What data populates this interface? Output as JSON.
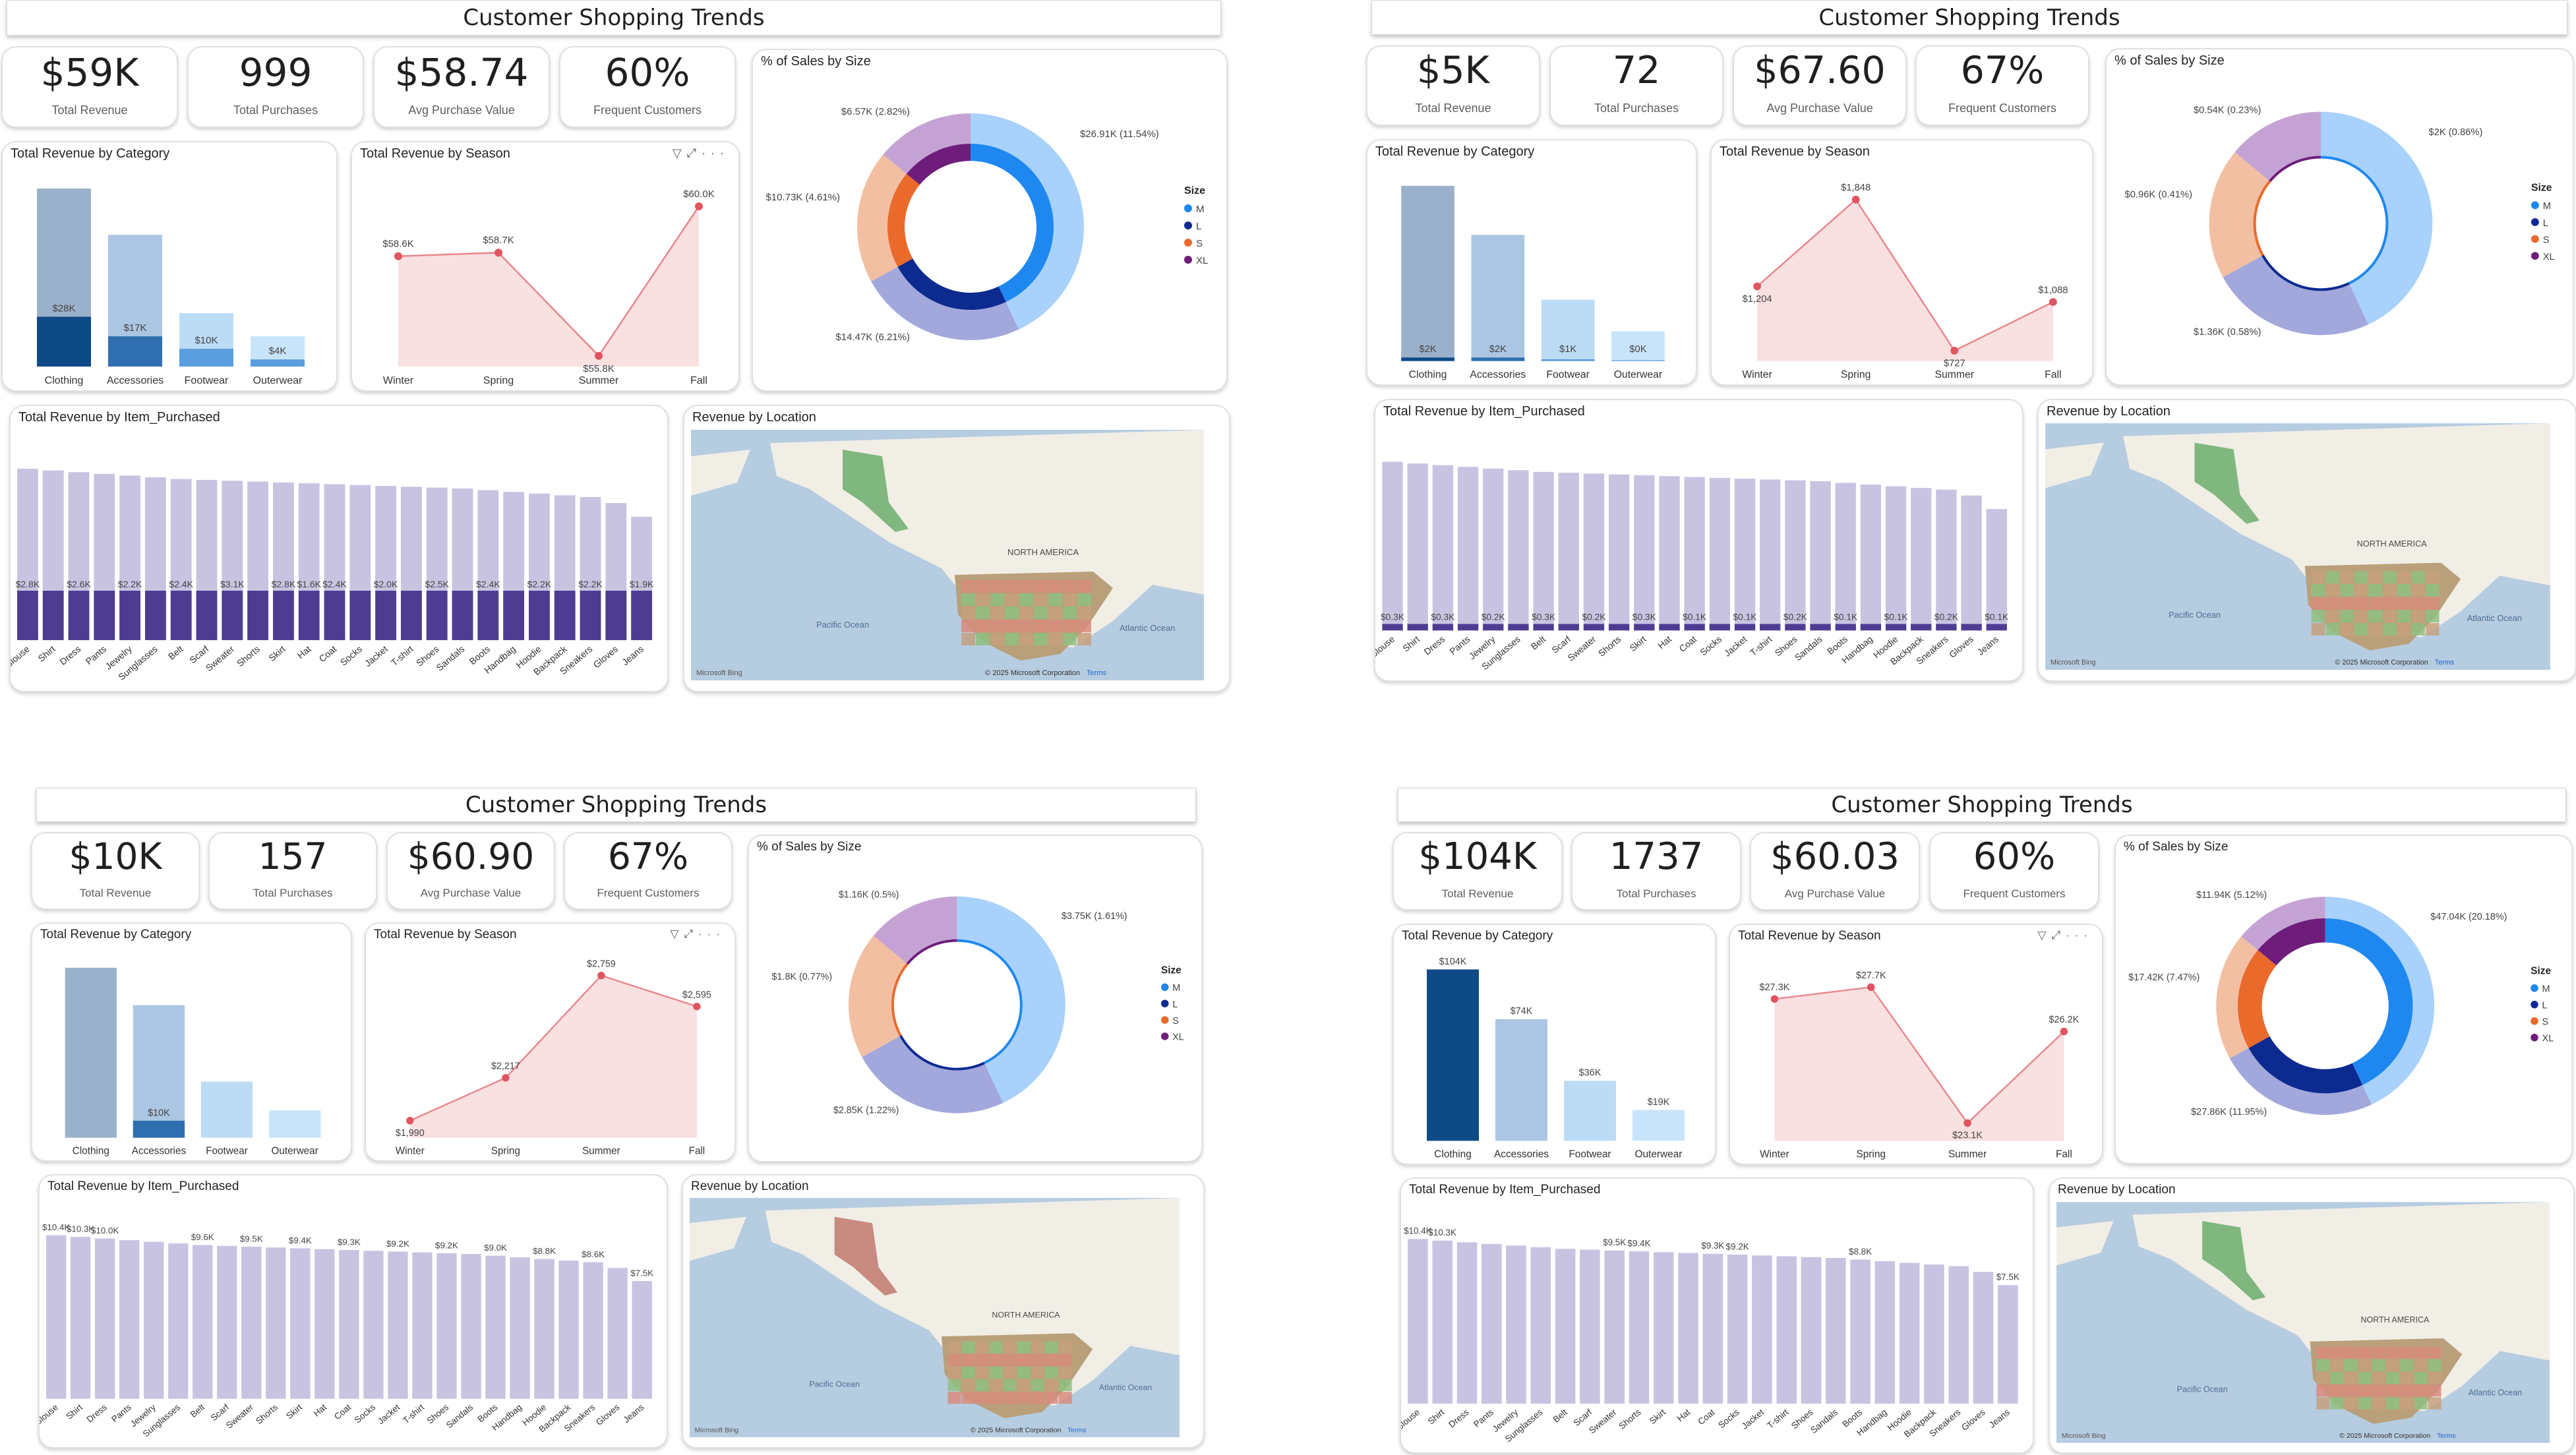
{
  "colors": {
    "cat_dark": [
      "#9bb1cb",
      "#abc6e2",
      "#bcdcf6",
      "#c8e4fa"
    ],
    "cat_fill_low": "#0e4a86",
    "season_line": "#e8868c",
    "season_fill": "#f9e0e1",
    "item_bar": "#c9c3e2",
    "item_bar_dark": "#4e3c93",
    "size_M": "#1e88f0",
    "size_L": "#0c2a8f",
    "size_S": "#ea6a2c",
    "size_XL": "#6e1e7a",
    "map_water": "#b6cce0",
    "map_land": "#f1eee6"
  },
  "dashboards": [
    {
      "title": "Customer Shopping Trends",
      "kpis": [
        {
          "value": "$59K",
          "label": "Total Revenue"
        },
        {
          "value": "999",
          "label": "Total Purchases"
        },
        {
          "value": "$58.74",
          "label": "Avg Purchase Value"
        },
        {
          "value": "60%",
          "label": "Frequent Customers"
        }
      ],
      "category": {
        "title": "Total Revenue by Category",
        "categories": [
          "Clothing",
          "Accessories",
          "Footwear",
          "Outerwear"
        ],
        "bg_values": [
          1.0,
          0.74,
          0.3,
          0.17
        ],
        "values": [
          0.28,
          0.17,
          0.1,
          0.04
        ],
        "labels": [
          "$28K",
          "$17K",
          "$10K",
          "$4K"
        ]
      },
      "season": {
        "title": "Total Revenue by Season",
        "categories": [
          "Winter",
          "Spring",
          "Summer",
          "Fall"
        ],
        "values": [
          58.6,
          58.7,
          55.8,
          60.0
        ],
        "labels": [
          "$58.6K",
          "$58.7K",
          "$55.8K",
          "$60.0K"
        ],
        "ylim": [
          55.5,
          60.5
        ],
        "tool_filter": "▽",
        "tool_focus": "⤢",
        "tool_more": "···"
      },
      "size": {
        "title": "% of Sales by Size",
        "legend_title": "Size",
        "legend": [
          "M",
          "L",
          "S",
          "XL"
        ],
        "labels": [
          "$26.91K (11.54%)",
          "$14.47K (6.21%)",
          "$10.73K (4.61%)",
          "$6.57K (2.82%)"
        ]
      },
      "items": {
        "title": "Total Revenue by Item_Purchased",
        "categories": [
          "Blouse",
          "Shirt",
          "Dress",
          "Pants",
          "Jewelry",
          "Sunglasses",
          "Belt",
          "Scarf",
          "Sweater",
          "Shorts",
          "Skirt",
          "Hat",
          "Coat",
          "Socks",
          "Jacket",
          "T-shirt",
          "Shoes",
          "Sandals",
          "Boots",
          "Handbag",
          "Hoodie",
          "Backpack",
          "Sneakers",
          "Gloves",
          "Jeans"
        ],
        "labels": [
          "$2.8K",
          "",
          "$2.6K",
          "",
          "$2.2K",
          "",
          "$2.4K",
          "",
          "$3.1K",
          "",
          "$2.8K",
          "$1.6K",
          "$2.4K",
          "",
          "$2.0K",
          "",
          "$2.5K",
          "",
          "$2.4K",
          "",
          "$2.2K",
          "",
          "$2.2K",
          "",
          "$1.9K"
        ]
      },
      "map": {
        "title": "Revenue by Location",
        "continent": "NORTH AMERICA",
        "ocean1": "Pacific Ocean",
        "ocean2": "Atlantic Ocean",
        "brand": "Microsoft Bing",
        "copyright": "© 2025 Microsoft Corporation",
        "terms": "Terms"
      }
    },
    {
      "title": "Customer Shopping Trends",
      "kpis": [
        {
          "value": "$5K",
          "label": "Total Revenue"
        },
        {
          "value": "72",
          "label": "Total Purchases"
        },
        {
          "value": "$67.60",
          "label": "Avg Purchase Value"
        },
        {
          "value": "67%",
          "label": "Frequent Customers"
        }
      ],
      "category": {
        "title": "Total Revenue by Category",
        "categories": [
          "Clothing",
          "Accessories",
          "Footwear",
          "Outerwear"
        ],
        "bg_values": [
          1.0,
          0.72,
          0.35,
          0.17
        ],
        "values": [
          0.02,
          0.02,
          0.01,
          0.005
        ],
        "labels": [
          "$2K",
          "$2K",
          "$1K",
          "$0K"
        ]
      },
      "season": {
        "title": "Total Revenue by Season",
        "categories": [
          "Winter",
          "Spring",
          "Summer",
          "Fall"
        ],
        "values": [
          1204,
          1848,
          727,
          1088
        ],
        "labels": [
          "$1,204",
          "$1,848",
          "$727",
          "$1,088"
        ],
        "ylim": [
          650,
          1950
        ],
        "tool_filter": "",
        "tool_focus": "",
        "tool_more": ""
      },
      "size": {
        "title": "% of Sales by Size",
        "legend_title": "Size",
        "legend": [
          "M",
          "L",
          "S",
          "XL"
        ],
        "labels": [
          "$2K (0.86%)",
          "$1.36K (0.58%)",
          "$0.96K (0.41%)",
          "$0.54K (0.23%)"
        ]
      },
      "items": {
        "title": "Total Revenue by Item_Purchased",
        "categories": [
          "Blouse",
          "Shirt",
          "Dress",
          "Pants",
          "Jewelry",
          "Sunglasses",
          "Belt",
          "Scarf",
          "Sweater",
          "Shorts",
          "Skirt",
          "Hat",
          "Coat",
          "Socks",
          "Jacket",
          "T-shirt",
          "Shoes",
          "Sandals",
          "Boots",
          "Handbag",
          "Hoodie",
          "Backpack",
          "Sneakers",
          "Gloves",
          "Jeans"
        ],
        "labels": [
          "$0.3K",
          "",
          "$0.3K",
          "",
          "$0.2K",
          "",
          "$0.3K",
          "",
          "$0.2K",
          "",
          "$0.3K",
          "",
          "$0.1K",
          "",
          "$0.1K",
          "",
          "$0.2K",
          "",
          "$0.1K",
          "",
          "$0.1K",
          "",
          "$0.2K",
          "",
          "$0.1K"
        ]
      },
      "map": {
        "title": "Revenue by Location",
        "continent": "NORTH AMERICA",
        "ocean1": "Pacific Ocean",
        "ocean2": "Atlantic Ocean",
        "brand": "Microsoft Bing",
        "copyright": "© 2025 Microsoft Corporation",
        "terms": "Terms"
      }
    },
    {
      "title": "Customer Shopping Trends",
      "kpis": [
        {
          "value": "$10K",
          "label": "Total Revenue"
        },
        {
          "value": "157",
          "label": "Total Purchases"
        },
        {
          "value": "$60.90",
          "label": "Avg Purchase Value"
        },
        {
          "value": "67%",
          "label": "Frequent Customers"
        }
      ],
      "category": {
        "title": "Total Revenue by Category",
        "categories": [
          "Clothing",
          "Accessories",
          "Footwear",
          "Outerwear"
        ],
        "bg_values": [
          1.0,
          0.78,
          0.33,
          0.16
        ],
        "values": [
          0.0,
          0.1,
          0.0,
          0.0
        ],
        "labels": [
          "",
          "$10K",
          "",
          ""
        ]
      },
      "season": {
        "title": "Total Revenue by Season",
        "categories": [
          "Winter",
          "Spring",
          "Summer",
          "Fall"
        ],
        "values": [
          1990,
          2217,
          2759,
          2595
        ],
        "labels": [
          "$1,990",
          "$2,217",
          "$2,759",
          "$2,595"
        ],
        "ylim": [
          1900,
          2800
        ],
        "tool_filter": "▽",
        "tool_focus": "⤢",
        "tool_more": "···"
      },
      "size": {
        "title": "% of Sales by Size",
        "legend_title": "Size",
        "legend": [
          "M",
          "L",
          "S",
          "XL"
        ],
        "labels": [
          "$3.75K (1.61%)",
          "$2.85K (1.22%)",
          "$1.8K (0.77%)",
          "$1.16K (0.5%)"
        ]
      },
      "items": {
        "title": "Total Revenue by Item_Purchased",
        "categories": [
          "Blouse",
          "Shirt",
          "Dress",
          "Pants",
          "Jewelry",
          "Sunglasses",
          "Belt",
          "Scarf",
          "Sweater",
          "Shorts",
          "Skirt",
          "Hat",
          "Coat",
          "Socks",
          "Jacket",
          "T-shirt",
          "Shoes",
          "Sandals",
          "Boots",
          "Handbag",
          "Hoodie",
          "Backpack",
          "Sneakers",
          "Gloves",
          "Jeans"
        ],
        "labels": [
          "$10.4K",
          "$10.3K",
          "$10.0K",
          "",
          "",
          "",
          "$9.6K",
          "",
          "$9.5K",
          "",
          "$9.4K",
          "",
          "$9.3K",
          "",
          "$9.2K",
          "",
          "$9.2K",
          "",
          "$9.0K",
          "",
          "$8.8K",
          "",
          "$8.6K",
          "",
          "$7.5K"
        ]
      },
      "map": {
        "title": "Revenue by Location",
        "continent": "NORTH AMERICA",
        "ocean1": "Pacific Ocean",
        "ocean2": "Atlantic Ocean",
        "brand": "Microsoft Bing",
        "copyright": "© 2025 Microsoft Corporation",
        "terms": "Terms"
      }
    },
    {
      "title": "Customer Shopping Trends",
      "kpis": [
        {
          "value": "$104K",
          "label": "Total Revenue"
        },
        {
          "value": "1737",
          "label": "Total Purchases"
        },
        {
          "value": "$60.03",
          "label": "Avg Purchase Value"
        },
        {
          "value": "60%",
          "label": "Frequent Customers"
        }
      ],
      "category": {
        "title": "Total Revenue by Category",
        "categories": [
          "Clothing",
          "Accessories",
          "Footwear",
          "Outerwear"
        ],
        "bg_values": [
          1.0,
          0.71,
          0.35,
          0.18
        ],
        "values": [
          1.0,
          0.0,
          0.0,
          0.0
        ],
        "labels": [
          "$104K",
          "$74K",
          "$36K",
          "$19K"
        ]
      },
      "season": {
        "title": "Total Revenue by Season",
        "categories": [
          "Winter",
          "Spring",
          "Summer",
          "Fall"
        ],
        "values": [
          27.3,
          27.7,
          23.1,
          26.2
        ],
        "labels": [
          "$27.3K",
          "$27.7K",
          "$23.1K",
          "$26.2K"
        ],
        "ylim": [
          22.5,
          28.3
        ],
        "tool_filter": "▽",
        "tool_focus": "⤢",
        "tool_more": "···"
      },
      "size": {
        "title": "% of Sales by Size",
        "legend_title": "Size",
        "legend": [
          "M",
          "L",
          "S",
          "XL"
        ],
        "labels": [
          "$47.04K (20.18%)",
          "$27.86K (11.95%)",
          "$17.42K (7.47%)",
          "$11.94K (5.12%)"
        ]
      },
      "items": {
        "title": "Total Revenue by Item_Purchased",
        "categories": [
          "Blouse",
          "Shirt",
          "Dress",
          "Pants",
          "Jewelry",
          "Sunglasses",
          "Belt",
          "Scarf",
          "Sweater",
          "Shorts",
          "Skirt",
          "Hat",
          "Coat",
          "Socks",
          "Jacket",
          "T-shirt",
          "Shoes",
          "Sandals",
          "Boots",
          "Handbag",
          "Hoodie",
          "Backpack",
          "Sneakers",
          "Gloves",
          "Jeans"
        ],
        "labels": [
          "$10.4K",
          "$10.3K",
          "",
          "",
          "",
          "",
          "",
          "",
          "$9.5K",
          "$9.4K",
          "",
          "",
          "$9.3K",
          "$9.2K",
          "",
          "",
          "",
          "",
          "$8.8K",
          "",
          "",
          "",
          "",
          "",
          "$7.5K"
        ]
      },
      "map": {
        "title": "Revenue by Location",
        "continent": "NORTH AMERICA",
        "ocean1": "Pacific Ocean",
        "ocean2": "Atlantic Ocean",
        "brand": "Microsoft Bing",
        "copyright": "© 2025 Microsoft Corporation",
        "terms": "Terms"
      }
    }
  ]
}
